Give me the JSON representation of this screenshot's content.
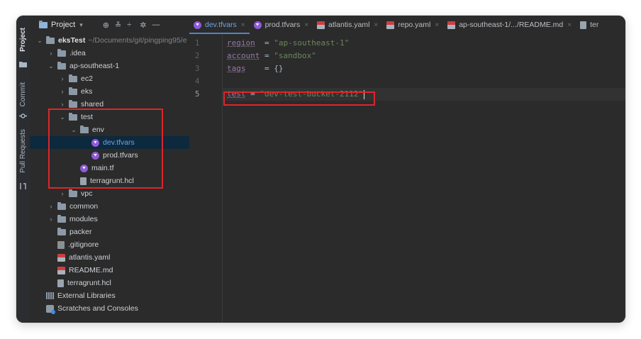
{
  "strip": {
    "project_label": "Project",
    "commit_label": "Commit",
    "pull_requests_label": "Pull Requests"
  },
  "panel": {
    "title": "Project",
    "tree": [
      {
        "label": "eksTest",
        "path": "~/Documents/git/pingping95/e",
        "indent": 0,
        "chev": "down",
        "icon": "folder"
      },
      {
        "label": ".idea",
        "indent": 1,
        "chev": "right",
        "icon": "folder"
      },
      {
        "label": "ap-southeast-1",
        "indent": 1,
        "chev": "down",
        "icon": "folder"
      },
      {
        "label": "ec2",
        "indent": 2,
        "chev": "right",
        "icon": "folder"
      },
      {
        "label": "eks",
        "indent": 2,
        "chev": "right",
        "icon": "folder"
      },
      {
        "label": "shared",
        "indent": 2,
        "chev": "right",
        "icon": "folder"
      },
      {
        "label": "test",
        "indent": 2,
        "chev": "down",
        "icon": "folder"
      },
      {
        "label": "env",
        "indent": 3,
        "chev": "down",
        "icon": "folder"
      },
      {
        "label": "dev.tfvars",
        "indent": 4,
        "chev": "",
        "icon": "terraform",
        "selected": true
      },
      {
        "label": "prod.tfvars",
        "indent": 4,
        "chev": "",
        "icon": "terraform"
      },
      {
        "label": "main.tf",
        "indent": 3,
        "chev": "",
        "icon": "terraform"
      },
      {
        "label": "terragrunt.hcl",
        "indent": 3,
        "chev": "",
        "icon": "file"
      },
      {
        "label": "vpc",
        "indent": 2,
        "chev": "right",
        "icon": "folder"
      },
      {
        "label": "common",
        "indent": 1,
        "chev": "right",
        "icon": "folder"
      },
      {
        "label": "modules",
        "indent": 1,
        "chev": "right",
        "icon": "folder"
      },
      {
        "label": "packer",
        "indent": 1,
        "chev": "",
        "icon": "folder"
      },
      {
        "label": ".gitignore",
        "indent": 1,
        "chev": "",
        "icon": "git"
      },
      {
        "label": "atlantis.yaml",
        "indent": 1,
        "chev": "",
        "icon": "yaml"
      },
      {
        "label": "README.md",
        "indent": 1,
        "chev": "",
        "icon": "yaml"
      },
      {
        "label": "terragrunt.hcl",
        "indent": 1,
        "chev": "",
        "icon": "file"
      },
      {
        "label": "External Libraries",
        "indent": 0,
        "chev": "",
        "icon": "library"
      },
      {
        "label": "Scratches and Consoles",
        "indent": 0,
        "chev": "",
        "icon": "scratches"
      }
    ]
  },
  "tabs": [
    {
      "label": "dev.tfvars",
      "icon": "terraform",
      "active": true,
      "close": "×"
    },
    {
      "label": "prod.tfvars",
      "icon": "terraform",
      "close": "×"
    },
    {
      "label": "atlantis.yaml",
      "icon": "yaml",
      "close": "×"
    },
    {
      "label": "repo.yaml",
      "icon": "yaml",
      "close": "×"
    },
    {
      "label": "ap-southeast-1/.../README.md",
      "icon": "yaml",
      "close": "×"
    },
    {
      "label": "ter",
      "icon": "file",
      "close": ""
    }
  ],
  "editor": {
    "line_numbers": [
      "1",
      "2",
      "3",
      "4",
      "5"
    ],
    "current_line": 5,
    "lines": [
      {
        "key": "region",
        "op": "  = ",
        "value": "\"ap-southeast-1\""
      },
      {
        "key": "account",
        "op": " = ",
        "value": "\"sandbox\""
      },
      {
        "key": "tags",
        "op": "    = ",
        "value": "{}"
      },
      {
        "key": "",
        "op": "",
        "value": ""
      },
      {
        "key": "test",
        "op": " = ",
        "value": "\"dev-test-bucket-2112\""
      }
    ]
  },
  "colors": {
    "highlight_box": "#e0242a",
    "terraform_icon": "#8e5bd9",
    "active_tab": "#6fa4e8"
  }
}
